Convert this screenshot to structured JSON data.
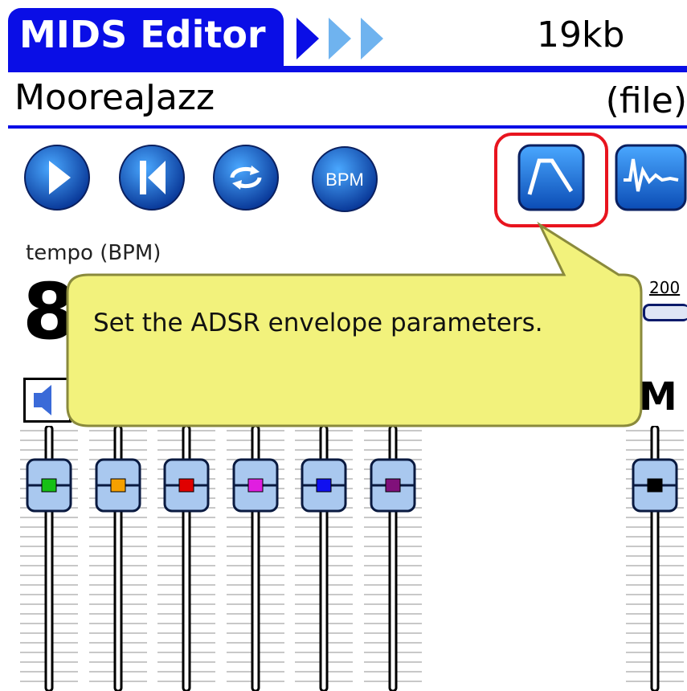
{
  "app": {
    "title": "MIDS Editor",
    "file_size": "19kb",
    "document_name": "MooreaJazz",
    "file_label": "(file)"
  },
  "toolbar": {
    "buttons": [
      {
        "name": "play",
        "icon": "play-icon"
      },
      {
        "name": "rewind",
        "icon": "skip-back-icon"
      },
      {
        "name": "loop",
        "icon": "loop-icon"
      },
      {
        "name": "bpm",
        "icon": "bpm-icon",
        "label": "BPM"
      },
      {
        "name": "adsr-envelope",
        "icon": "envelope-icon",
        "highlighted": true
      },
      {
        "name": "waveform",
        "icon": "waveform-icon"
      }
    ]
  },
  "tempo": {
    "label": "tempo (BPM)",
    "value_visible": "8",
    "max_label": "200"
  },
  "tooltip": {
    "text": "Set the ADSR envelope parameters."
  },
  "mixer": {
    "master_label": "M",
    "channels": [
      {
        "color": "#16c016"
      },
      {
        "color": "#f5a000"
      },
      {
        "color": "#e00000"
      },
      {
        "color": "#e01ee0"
      },
      {
        "color": "#1010f0"
      },
      {
        "color": "#80107a"
      }
    ],
    "master_color": "#000000"
  },
  "colors": {
    "brand_blue": "#0a0ee6",
    "button_blue": "#1565c0",
    "tooltip_yellow": "#f3f27a",
    "highlight_red": "#e8141e"
  }
}
